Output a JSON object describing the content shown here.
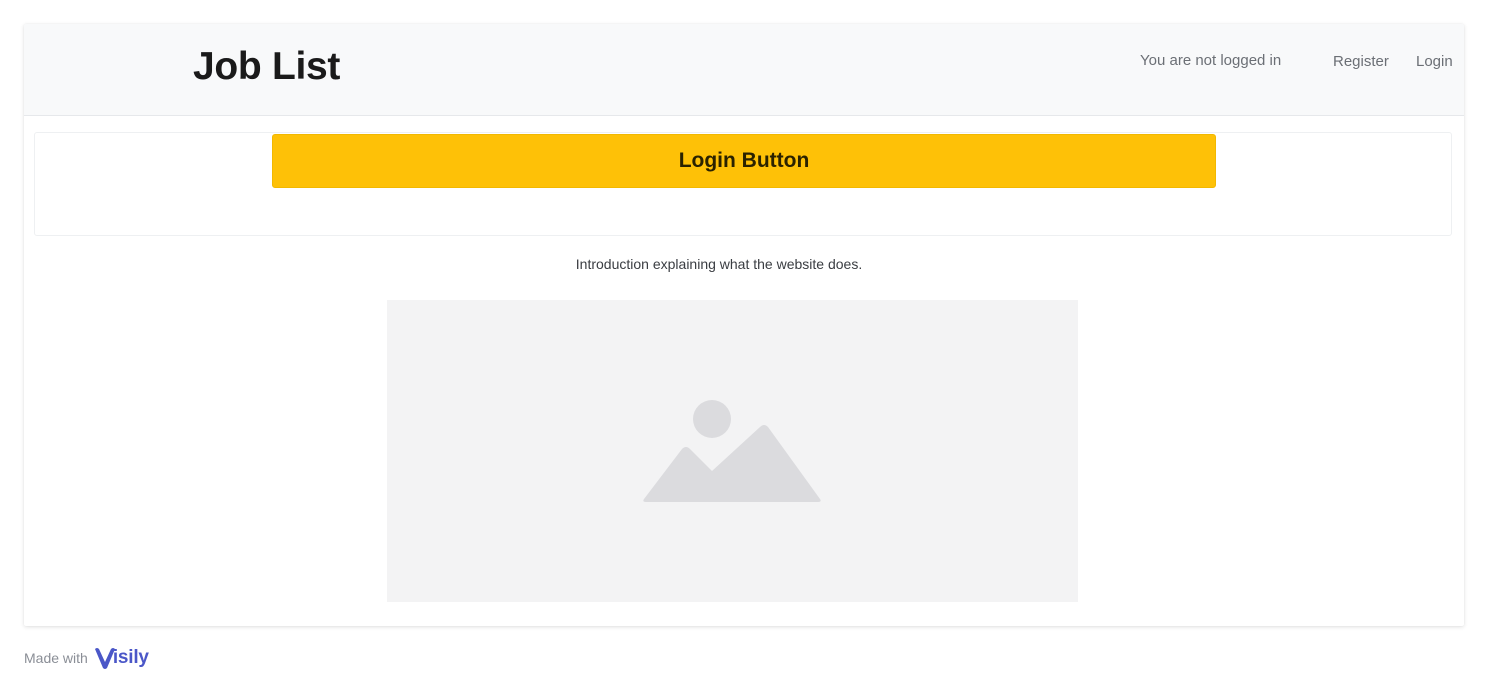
{
  "header": {
    "title": "Job List",
    "login_status": "You are not logged in",
    "nav": {
      "register": "Register",
      "login": "Login"
    }
  },
  "main": {
    "login_button_label": "Login Button",
    "intro_text": "Introduction explaining what the website does.",
    "image": {
      "icon": "image-placeholder-icon"
    }
  },
  "footer": {
    "made_with": "Made with",
    "brand": "isily",
    "brand_icon": "visily-v-icon"
  },
  "colors": {
    "accent": "#fec107",
    "header_bg": "#f8f9fa",
    "placeholder_bg": "#f3f3f4",
    "brand": "#4b57c8"
  }
}
